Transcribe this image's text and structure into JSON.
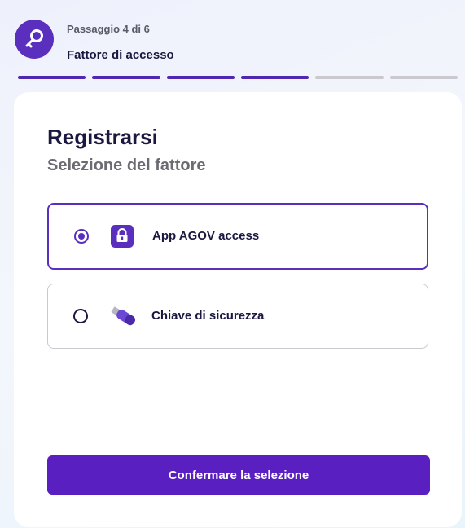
{
  "header": {
    "step_counter": "Passaggio 4 di 6",
    "step_title": "Fattore di accesso",
    "avatar_icon": "key-icon",
    "progress": {
      "total": 6,
      "completed": 4
    }
  },
  "main": {
    "title": "Registrarsi",
    "subtitle": "Selezione del fattore",
    "options": [
      {
        "label": "App AGOV access",
        "icon": "lock-app-icon",
        "selected": true
      },
      {
        "label": "Chiave di sicurezza",
        "icon": "usb-key-icon",
        "selected": false
      }
    ],
    "confirm_label": "Confermare la selezione"
  },
  "colors": {
    "accent": "#5a2fbd",
    "button": "#5a1fc0",
    "text_dark": "#1b1840",
    "progress_inactive": "#c9c9cf"
  }
}
